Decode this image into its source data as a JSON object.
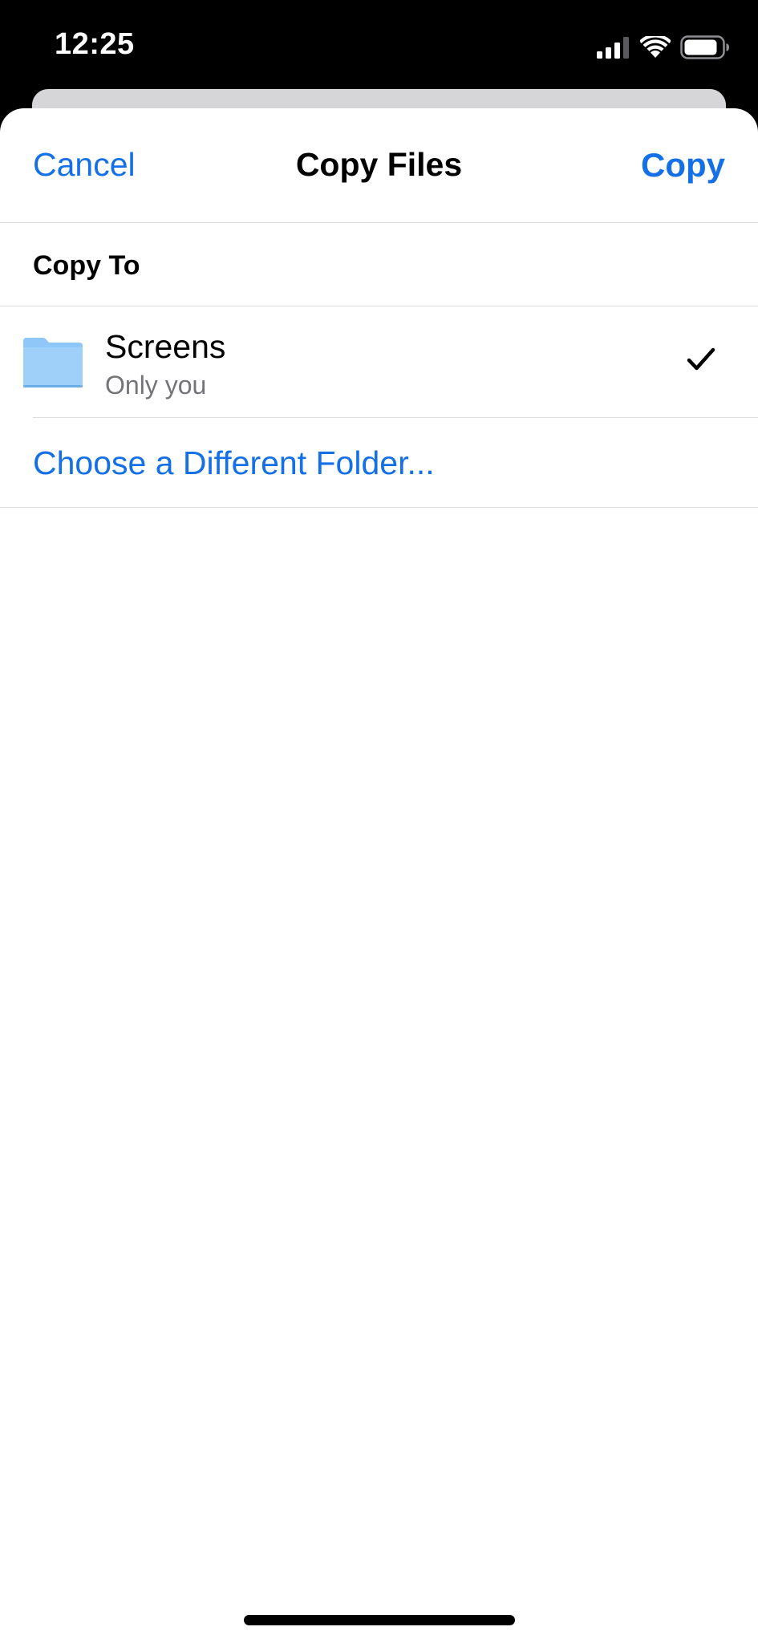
{
  "status_bar": {
    "time": "12:25",
    "icons": [
      "cellular-signal-icon",
      "wifi-icon",
      "battery-icon"
    ]
  },
  "nav": {
    "cancel_label": "Cancel",
    "title": "Copy Files",
    "copy_label": "Copy"
  },
  "section": {
    "header": "Copy To"
  },
  "destination": {
    "folder_name": "Screens",
    "folder_subtitle": "Only you",
    "selected": true,
    "icon": "folder-icon"
  },
  "choose_other_label": "Choose a Different Folder...",
  "colors": {
    "accent": "#1470e6",
    "folder": "#8fc8f8",
    "separator": "#dcdcde",
    "secondary_text": "#737378"
  }
}
